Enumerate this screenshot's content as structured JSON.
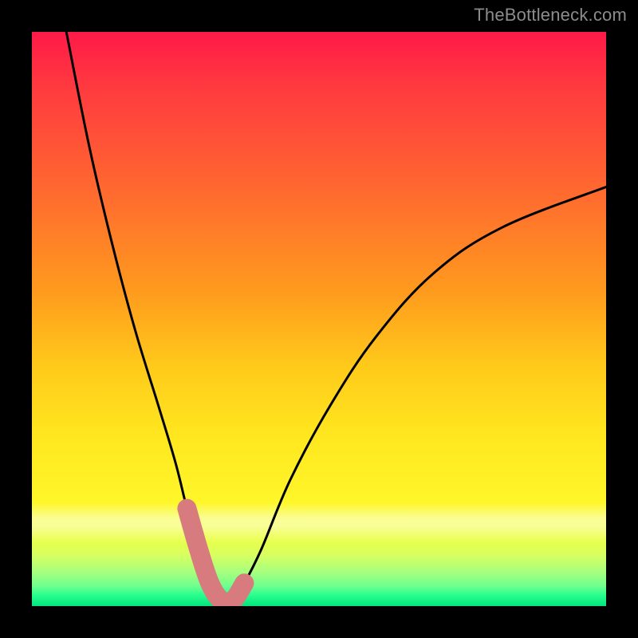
{
  "watermark": "TheBottleneck.com",
  "chart_data": {
    "type": "line",
    "title": "",
    "xlabel": "",
    "ylabel": "",
    "xlim": [
      0,
      100
    ],
    "ylim": [
      0,
      100
    ],
    "grid": false,
    "legend": false,
    "series": [
      {
        "name": "bottleneck-curve",
        "x": [
          6,
          10,
          14,
          18,
          22,
          25,
          27,
          29,
          31,
          33,
          35,
          37,
          40,
          45,
          52,
          60,
          70,
          82,
          100
        ],
        "y": [
          100,
          80,
          63,
          48,
          35,
          25,
          17,
          10,
          4,
          1,
          1,
          4,
          10,
          22,
          35,
          47,
          58,
          66,
          73
        ]
      }
    ],
    "annotations": [
      {
        "name": "highlight-range",
        "description": "pink/salmon thick segment near trough",
        "x_range": [
          27,
          37
        ],
        "color": "#d87b7e"
      },
      {
        "name": "highlight-dot",
        "x": 27,
        "y": 16,
        "color": "#d87b7e"
      }
    ],
    "background": {
      "type": "vertical-gradient",
      "stops": [
        {
          "pos": 0.0,
          "color": "#ff1a48"
        },
        {
          "pos": 0.45,
          "color": "#ff9a1e"
        },
        {
          "pos": 0.82,
          "color": "#fff72a"
        },
        {
          "pos": 0.95,
          "color": "#8dff86"
        },
        {
          "pos": 1.0,
          "color": "#00e57d"
        }
      ],
      "pale_band_y": [
        82,
        89
      ]
    }
  }
}
